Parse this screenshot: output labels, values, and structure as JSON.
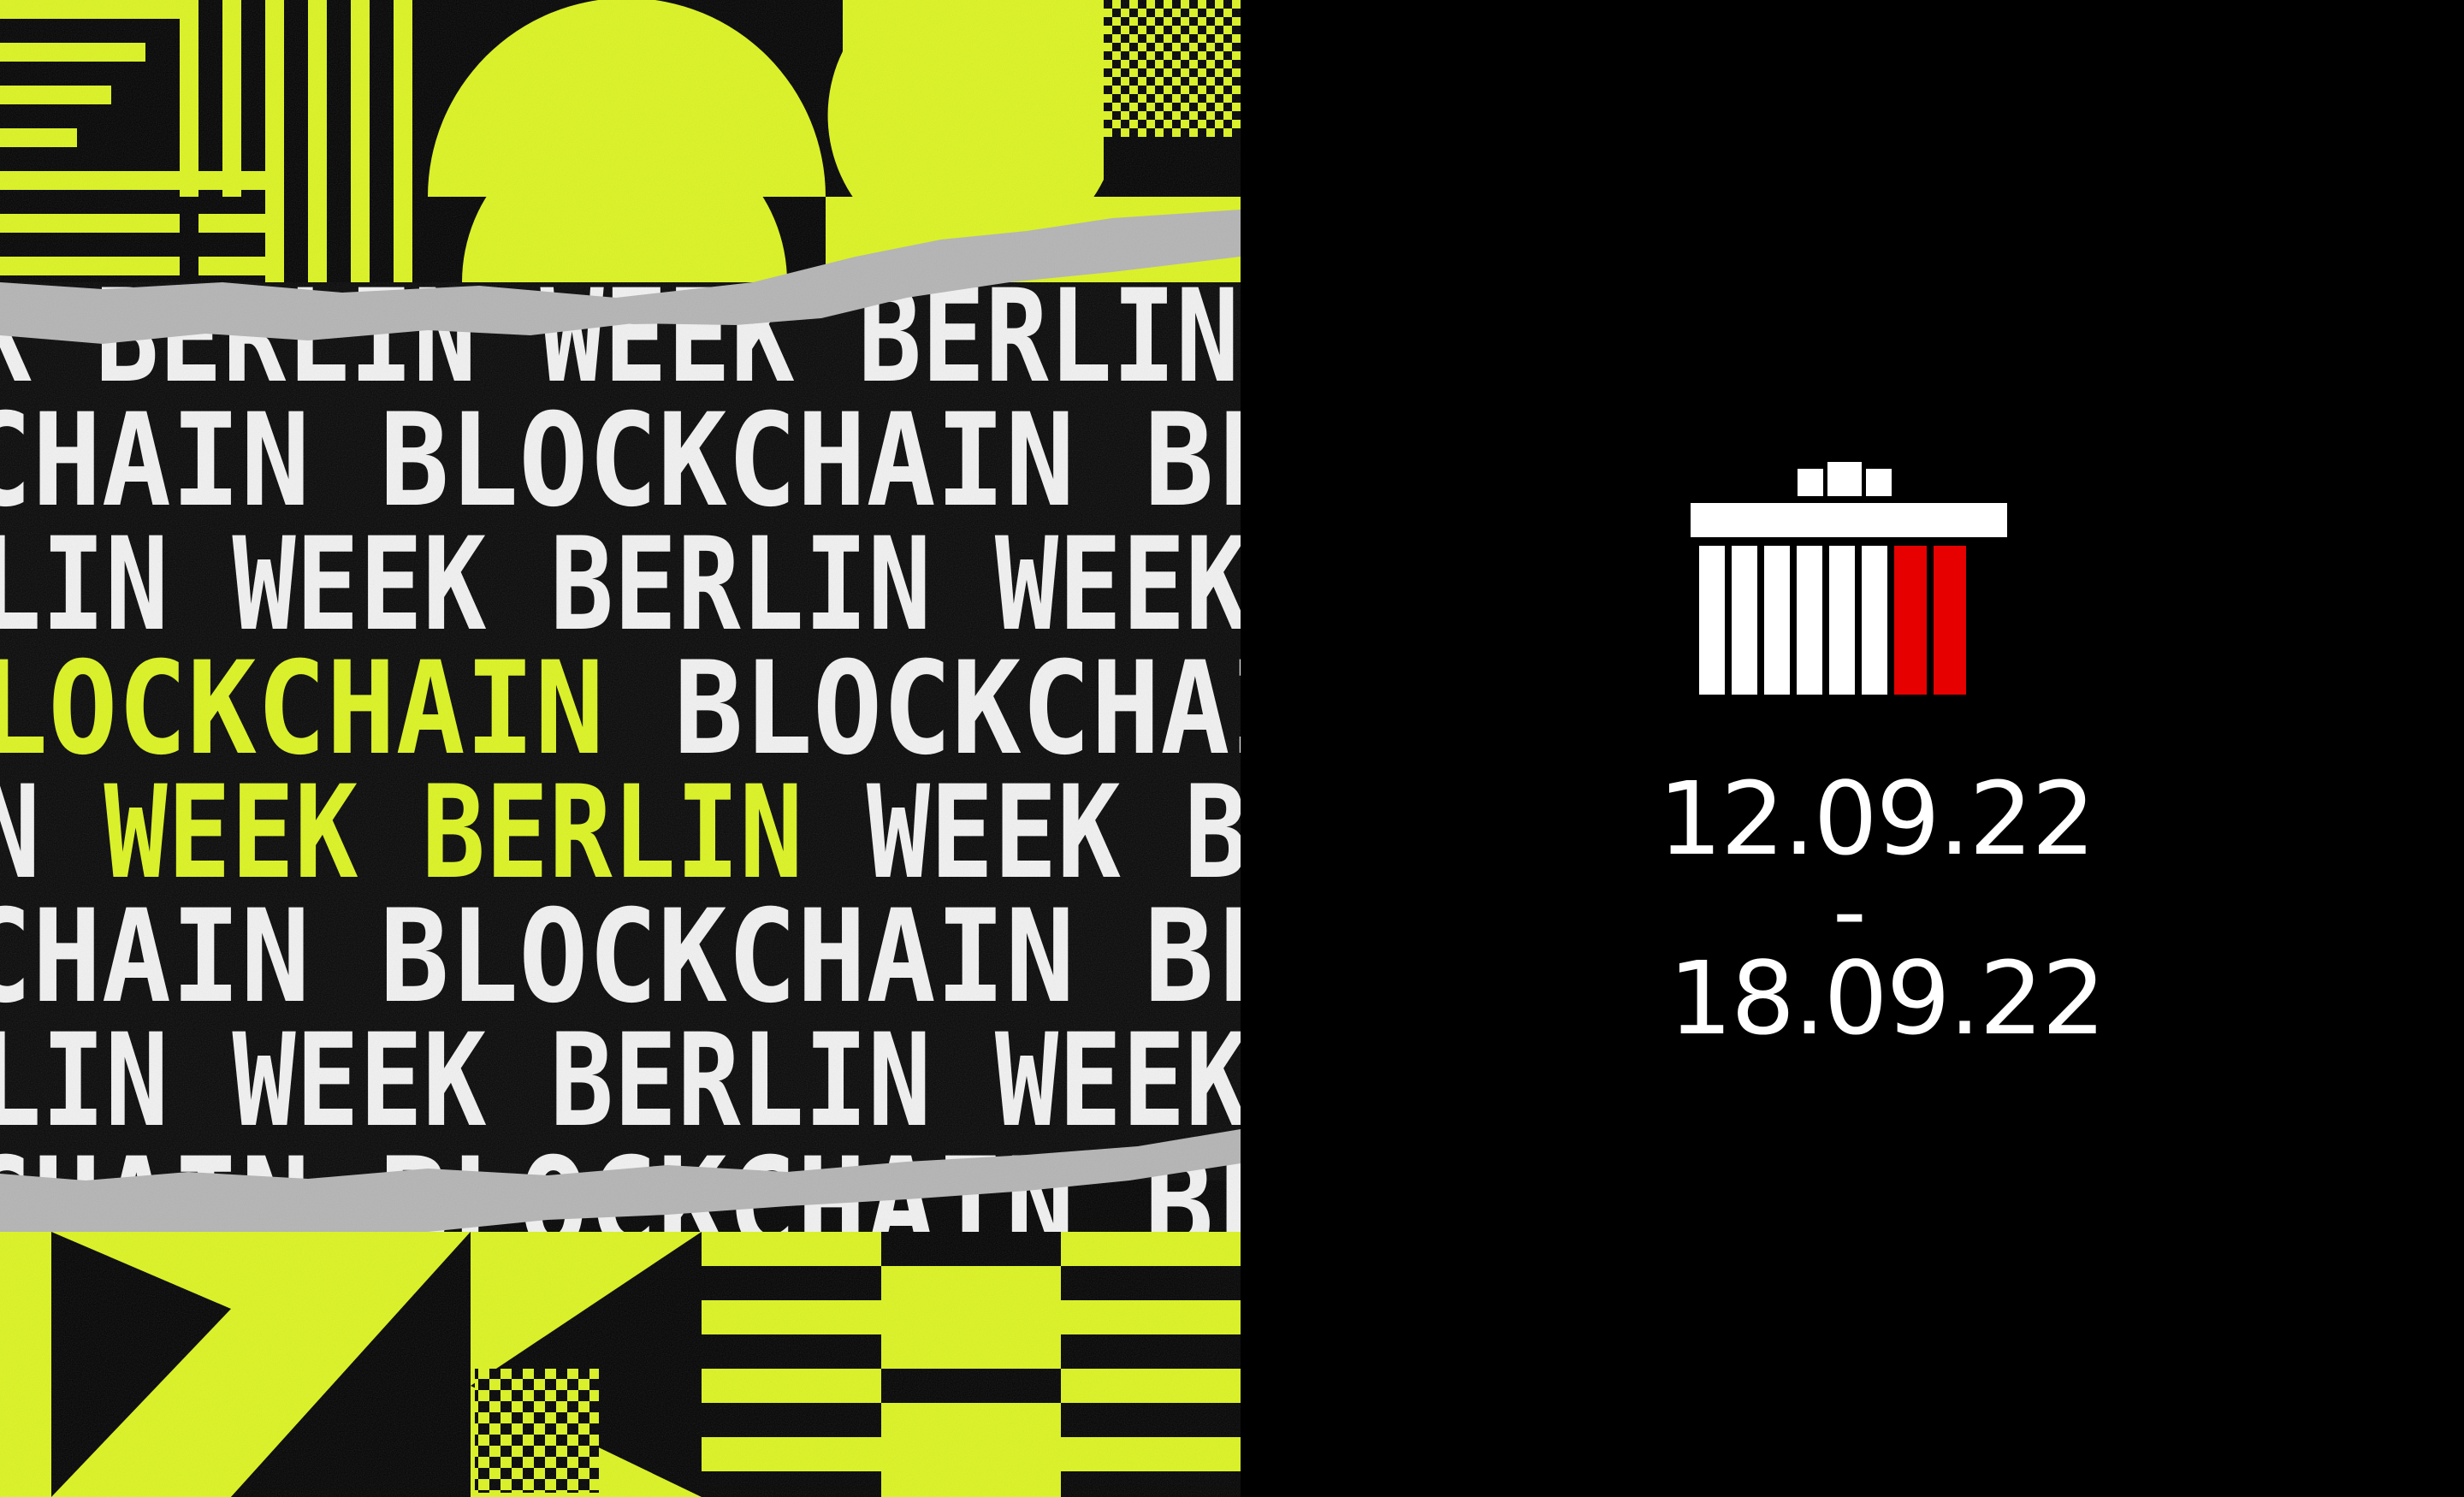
{
  "poster": {
    "rows": [
      {
        "text": "WEEK BERLIN WEEK BERLIN WEEK BERLIN",
        "offset": -260,
        "highlight": false
      },
      {
        "text": "BLOCKCHAIN BLOCKCHAIN BLOCKCHAIN",
        "offset": -450,
        "highlight": false
      },
      {
        "text": "WEEK BERLIN WEEK BERLIN WEEK BERLIN",
        "offset": -620,
        "highlight": false
      },
      {
        "text": "BLOCKCHAIN BLOCKCHAIN BLOCKCHAIN",
        "offset": -1000,
        "highlight": true
      },
      {
        "text": "WEEK BERLIN WEEK BERLIN WEEK BERLIN",
        "offset": -770,
        "highlight": true
      },
      {
        "text": "BLOCKCHAIN BLOCKCHAIN BLOCKCHAIN",
        "offset": -450,
        "highlight": false
      },
      {
        "text": "WEEK BERLIN WEEK BERLIN WEEK BERLIN",
        "offset": -620,
        "highlight": false
      },
      {
        "text": "BLOCKCHAIN BLOCKCHAIN BLOCKCHAIN",
        "offset": -450,
        "highlight": false
      }
    ],
    "highlight_words": 1
  },
  "event": {
    "start_date": "12.09.22",
    "separator": "-",
    "end_date": "18.09.22"
  },
  "colors": {
    "background": "#000000",
    "accent_lime": "#dcf51e",
    "text_white": "#f2f2f2",
    "paper_gray": "#b4b4b4",
    "logo_red": "#e60000",
    "logo_white": "#ffffff"
  },
  "icons": {
    "logo": "brandenburg-gate-icon"
  }
}
